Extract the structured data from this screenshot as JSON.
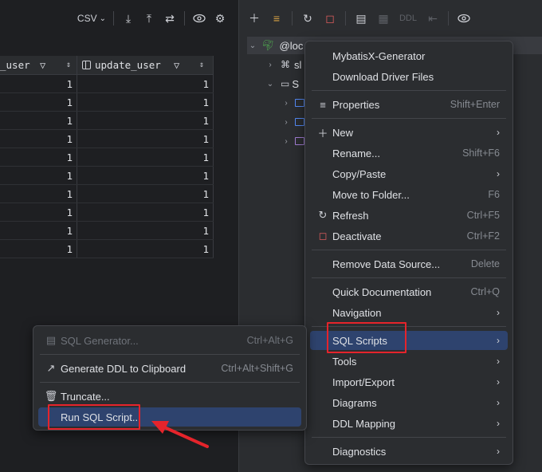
{
  "left_toolbar": {
    "format_label": "CSV"
  },
  "grid": {
    "col1_header": "_user",
    "col2_header": "update_user",
    "rows": [
      [
        "1",
        "1"
      ],
      [
        "1",
        "1"
      ],
      [
        "1",
        "1"
      ],
      [
        "1",
        "1"
      ],
      [
        "1",
        "1"
      ],
      [
        "1",
        "1"
      ],
      [
        "1",
        "1"
      ],
      [
        "1",
        "1"
      ],
      [
        "1",
        "1"
      ],
      [
        "1",
        "1"
      ]
    ]
  },
  "right_toolbar": {
    "ddl_label": "DDL"
  },
  "tree": {
    "root_label": "@loc",
    "node_1_label": "sl",
    "node_2_label": "S"
  },
  "context_menu": {
    "items": [
      {
        "label": "MybatisX-Generator"
      },
      {
        "label": "Download Driver Files"
      },
      {
        "label": "Properties",
        "shortcut": "Shift+Enter",
        "icon": "database-properties-icon"
      },
      {
        "label": "New",
        "icon": "plus-icon"
      },
      {
        "label": "Rename...",
        "shortcut": "Shift+F6"
      },
      {
        "label": "Copy/Paste"
      },
      {
        "label": "Move to Folder...",
        "shortcut": "F6"
      },
      {
        "label": "Refresh",
        "shortcut": "Ctrl+F5",
        "icon": "refresh-icon"
      },
      {
        "label": "Deactivate",
        "shortcut": "Ctrl+F2",
        "icon": "deactivate-icon"
      },
      {
        "label": "Remove Data Source...",
        "shortcut": "Delete"
      },
      {
        "label": "Quick Documentation",
        "shortcut": "Ctrl+Q"
      },
      {
        "label": "Navigation"
      },
      {
        "label": "SQL Scripts"
      },
      {
        "label": "Tools"
      },
      {
        "label": "Import/Export"
      },
      {
        "label": "Diagrams"
      },
      {
        "label": "DDL Mapping"
      },
      {
        "label": "Diagnostics"
      }
    ]
  },
  "submenu": {
    "items": [
      {
        "label": "SQL Generator...",
        "shortcut": "Ctrl+Alt+G",
        "disabled": true
      },
      {
        "label": "Generate DDL to Clipboard",
        "shortcut": "Ctrl+Alt+Shift+G"
      },
      {
        "label": "Truncate..."
      },
      {
        "label": "Run SQL Script..."
      }
    ]
  },
  "colors": {
    "highlight": "#2e436e",
    "annotation_red": "#e5242b",
    "background": "#1e1f22",
    "panel": "#2b2d30"
  }
}
